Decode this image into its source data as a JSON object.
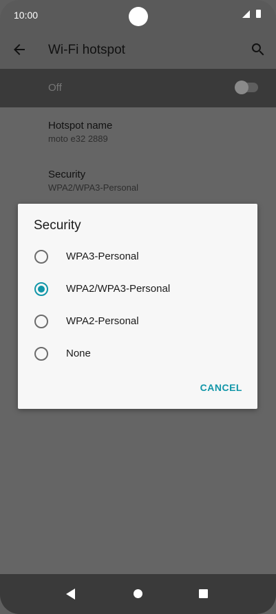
{
  "status_bar": {
    "time": "10:00"
  },
  "app_bar": {
    "title": "Wi-Fi hotspot"
  },
  "toggle": {
    "label": "Off",
    "state": "off"
  },
  "preferences": [
    {
      "title": "Hotspot name",
      "subtitle": "moto e32 2889"
    },
    {
      "title": "Security",
      "subtitle": "WPA2/WPA3-Personal"
    }
  ],
  "dialog": {
    "title": "Security",
    "options": [
      {
        "label": "WPA3-Personal",
        "selected": false
      },
      {
        "label": "WPA2/WPA3-Personal",
        "selected": true
      },
      {
        "label": "WPA2-Personal",
        "selected": false
      },
      {
        "label": "None",
        "selected": false
      }
    ],
    "cancel_label": "CANCEL"
  },
  "colors": {
    "accent": "#1196a8",
    "dialog_bg": "#f7f7f7",
    "scrim": "#656565"
  },
  "icons": [
    "back-arrow-icon",
    "search-icon",
    "signal-icon",
    "battery-icon",
    "nav-back-icon",
    "nav-home-icon",
    "nav-recents-icon"
  ]
}
